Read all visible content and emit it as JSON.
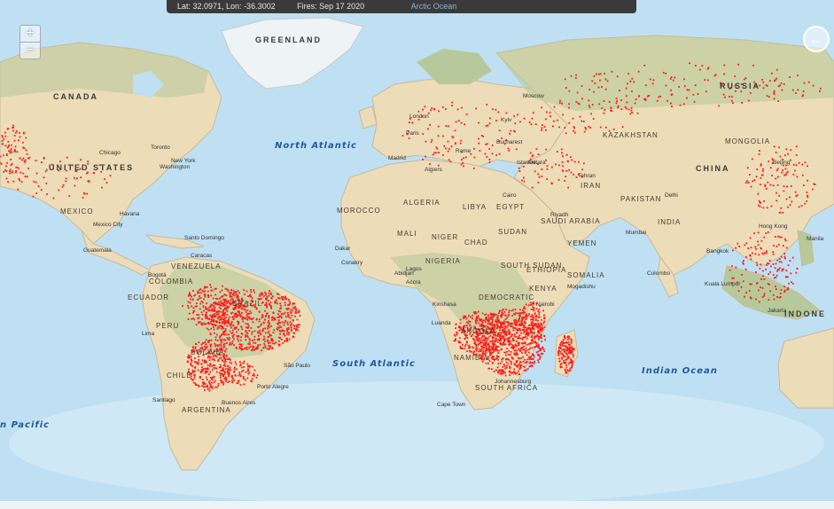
{
  "status_bar": {
    "coords": "Lat: 32.0971, Lon: -36.3002",
    "fires_date": "Fires: Sep 17 2020",
    "arctic_label": "Arctic Ocean"
  },
  "controls": {
    "zoom_in": "+",
    "zoom_out": "−",
    "back": "←"
  },
  "colors": {
    "ocean": "#bfe0f2",
    "land": "#ecdcb8",
    "vegetation": "#b7c99a",
    "ice": "#eef3f6",
    "fire": "#ff1a1a"
  },
  "oceans": {
    "north_atlantic": "North Atlantic",
    "south_atlantic": "South Atlantic",
    "indian": "Indian Ocean",
    "pacific": "n Pacific"
  },
  "regions": {
    "greenland": "GREENLAND",
    "canada": "CANADA",
    "united_states": "UNITED STATES",
    "mexico": "MEXICO",
    "russia": "RUSSIA",
    "kazakhstan": "KAZAKHSTAN",
    "mongolia": "MONGOLIA",
    "china": "CHINA",
    "algeria": "ALGERIA",
    "libya": "LIBYA",
    "egypt": "EGYPT",
    "morocco": "MOROCCO",
    "mali": "MALI",
    "niger": "NIGER",
    "chad": "CHAD",
    "sudan": "SUDAN",
    "nigeria": "NIGERIA",
    "ethiopia": "ETHIOPIA",
    "somalia": "SOMALIA",
    "kenya": "KENYA",
    "south_sudan": "SOUTH SUDAN",
    "angola": "ANGOLA",
    "namibia": "NAMIBIA",
    "south_africa": "SOUTH AFRICA",
    "drc": "DEMOCRATIC",
    "venezuela": "VENEZUELA",
    "colombia": "COLOMBIA",
    "ecuador": "ECUADOR",
    "peru": "PERU",
    "bolivia": "BOLIVIA",
    "chile": "CHILE",
    "argentina": "ARGENTINA",
    "brazil": "BRAZIL",
    "india": "INDIA",
    "pakistan": "PAKISTAN",
    "iran": "IRAN",
    "saudi_arabia": "SAUDI ARABIA",
    "yemen": "YEMEN",
    "indonesia": "INDONE",
    "philippines": "Manila"
  },
  "cities": {
    "toronto": "Toronto",
    "new_york": "New York",
    "washington": "Washington",
    "chicago": "Chicago",
    "havana": "Havana",
    "mexico_city": "Mexico City",
    "santo_domingo": "Santo Domingo",
    "caracas": "Caracas",
    "bogota": "Bogotá",
    "lima": "Lima",
    "sao_paulo": "São Paulo",
    "buenos_aires": "Buenos Aires",
    "santiago": "Santiago",
    "porto_alegre": "Porto Alegre",
    "london": "London",
    "paris": "Paris",
    "madrid": "Madrid",
    "rome": "Rome",
    "algiers": "Algiers",
    "cairo": "Cairo",
    "lagos": "Lagos",
    "kinshasa": "Kinshasa",
    "luanda": "Luanda",
    "johannesburg": "Johannesburg",
    "cape_town": "Cape Town",
    "nairobi": "Nairobi",
    "mogadishu": "Mogadishu",
    "riyadh": "Riyadh",
    "tehran": "Tehran",
    "delhi": "Delhi",
    "mumbai": "Mumbai",
    "colombo": "Colombo",
    "bangkok": "Bangkok",
    "hong_kong": "Hong Kong",
    "beijing": "Beijing",
    "jakarta": "Jakarta",
    "kuala_lumpur": "Kuala Lumpur",
    "istanbul": "Istanbul",
    "moscow": "Moscow",
    "kyiv": "Kyiv",
    "bucharest": "Bucharest",
    "ankara": "Ankara",
    "dakar": "Dakar",
    "conakry": "Conakry",
    "abidjan": "Abidjan",
    "accra": "Accra",
    "guatemala": "Guatemala"
  },
  "fire_regions": [
    {
      "name": "southern-africa",
      "intensity": "very-high"
    },
    {
      "name": "madagascar",
      "intensity": "high"
    },
    {
      "name": "brazil-amazon",
      "intensity": "very-high"
    },
    {
      "name": "bolivia-paraguay",
      "intensity": "high"
    },
    {
      "name": "west-us",
      "intensity": "medium"
    },
    {
      "name": "siberia",
      "intensity": "medium"
    },
    {
      "name": "southeast-asia",
      "intensity": "medium"
    },
    {
      "name": "europe",
      "intensity": "low"
    }
  ]
}
